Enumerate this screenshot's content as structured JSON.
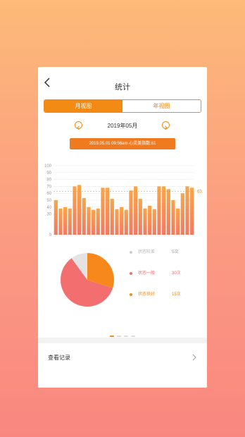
{
  "nav": {
    "title": "统计"
  },
  "tabs": [
    {
      "label": "月视图",
      "active": true
    },
    {
      "label": "年视图",
      "active": false
    }
  ],
  "month": {
    "label": "2019年05月"
  },
  "info": {
    "text": "2019.05.01 09:56am 心灵美指数:61"
  },
  "colors": {
    "accent": "#F28A14",
    "bar_top": "#F9A64A",
    "bar_bottom": "#F07A63",
    "pie_main": "#F36F6F",
    "pie_orange": "#F7891C",
    "pie_light": "#E3E3E3"
  },
  "chart_data": {
    "type": "bar",
    "y_ticks": [
      "100",
      "90",
      "80",
      "70",
      "60",
      "50",
      "40",
      "30",
      "0"
    ],
    "ylim": [
      0,
      100
    ],
    "reference_value": 63,
    "reference_label": "63",
    "values": [
      50,
      38,
      40,
      38,
      70,
      72,
      53,
      40,
      36,
      38,
      68,
      68,
      52,
      37,
      40,
      36,
      64,
      70,
      52,
      38,
      42,
      37,
      70,
      70,
      66,
      50,
      38,
      60,
      70,
      68
    ],
    "xlabel": "",
    "ylabel": "",
    "grid": true
  },
  "pie": {
    "slices": [
      {
        "name": "状态较差",
        "count": "5次",
        "value": 5,
        "color": "#E3E3E3"
      },
      {
        "name": "状态一般",
        "count": "30次",
        "value": 30,
        "color": "#F36F6F"
      },
      {
        "name": "状态良好",
        "count": "15次",
        "value": 15,
        "color": "#F7891C"
      }
    ]
  },
  "pager": {
    "count": 4,
    "active": 0
  },
  "records": {
    "label": "查看记录"
  }
}
